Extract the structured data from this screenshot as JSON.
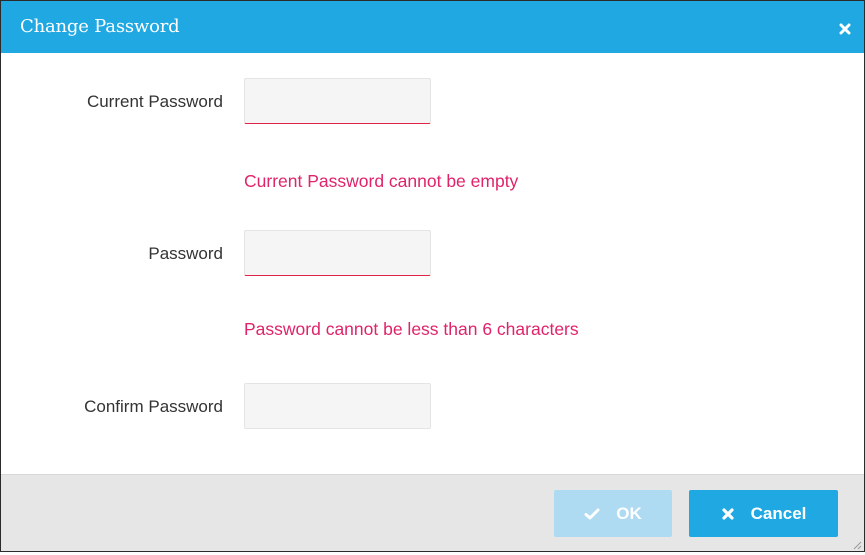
{
  "dialog": {
    "title": "Change Password",
    "close_icon": "close-icon"
  },
  "form": {
    "current_password": {
      "label": "Current Password",
      "value": "",
      "error": "Current Password cannot be empty"
    },
    "password": {
      "label": "Password",
      "value": "",
      "error": "Password cannot be less than 6 characters"
    },
    "confirm_password": {
      "label": "Confirm Password",
      "value": ""
    }
  },
  "footer": {
    "ok_label": "OK",
    "ok_icon": "checkmark-icon",
    "ok_disabled": true,
    "cancel_label": "Cancel",
    "cancel_icon": "close-icon"
  },
  "colors": {
    "accent": "#1fa8e2",
    "accent_disabled": "#aedbf2",
    "error": "#e0236a",
    "footer_bg": "#e6e6e6"
  }
}
